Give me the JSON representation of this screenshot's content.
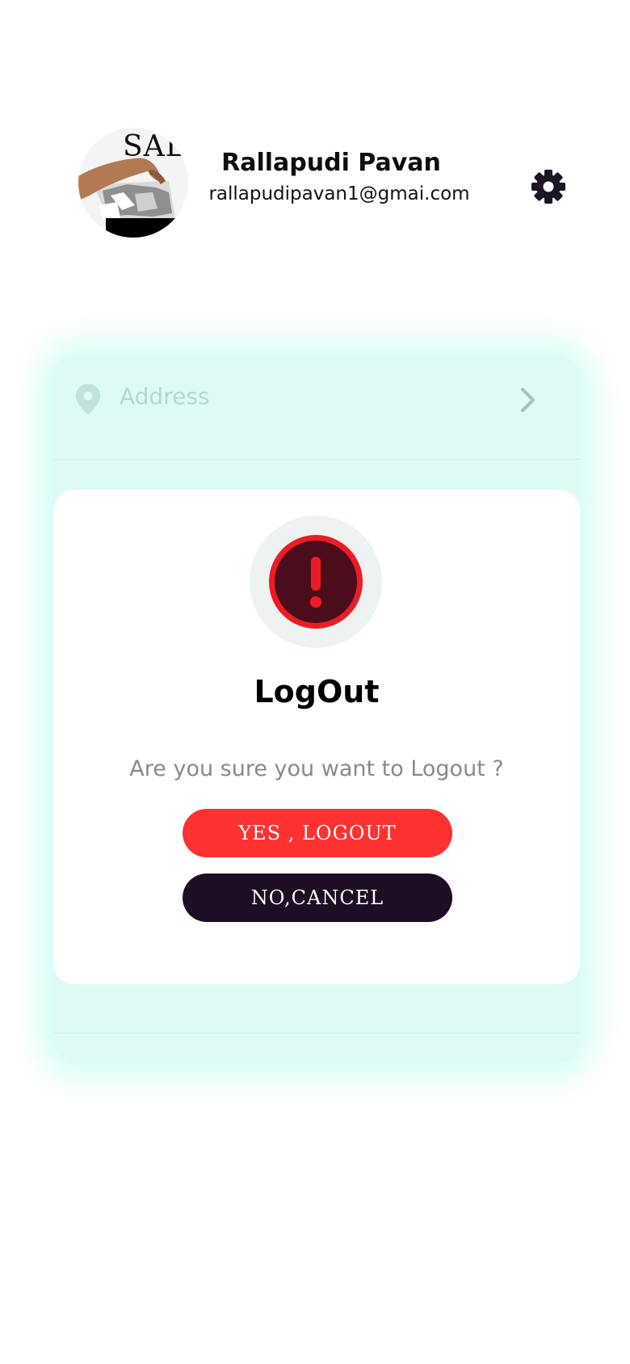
{
  "profile": {
    "avatar_text": "SALE",
    "name": "Rallapudi Pavan",
    "email": "rallapudipavan1@gmai.com",
    "settings_icon": "gear-icon"
  },
  "menu": {
    "items": [
      {
        "label": "Address",
        "icon": "location-pin-icon"
      }
    ]
  },
  "modal": {
    "icon": "alert-exclamation-icon",
    "title": "LogOut",
    "message": "Are you sure you want to Logout ?",
    "confirm_label": "YES , LOGOUT",
    "cancel_label": "NO,CANCEL"
  },
  "colors": {
    "confirm": "#ff3131",
    "cancel": "#1e0d25",
    "alert_red": "#ec1c24",
    "alert_dark": "#4b0d1b",
    "menu_tint": "#ddfaf5"
  }
}
